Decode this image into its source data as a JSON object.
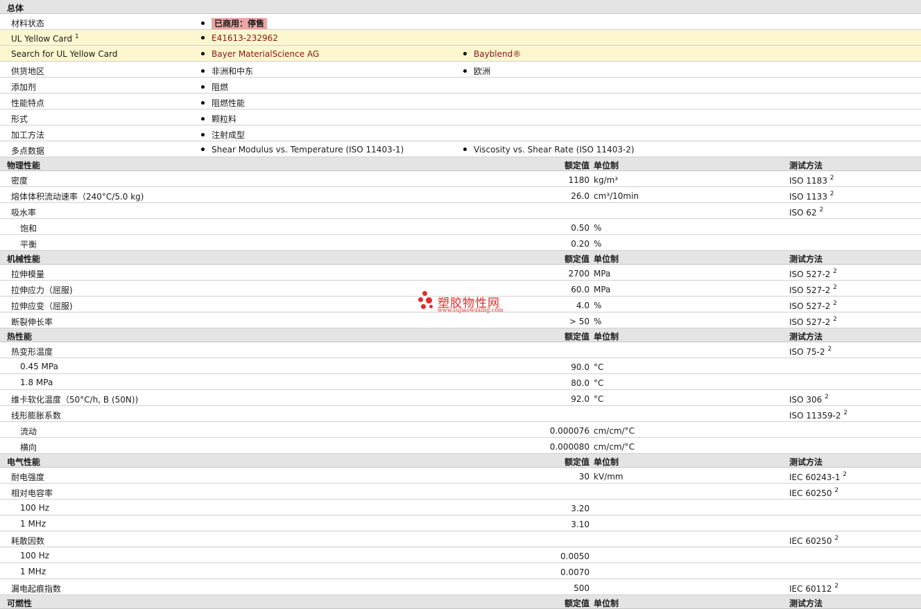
{
  "general": {
    "title": "总体",
    "material_status": {
      "label": "材料状态",
      "value": "已商用：停售"
    },
    "ul_yellow_card": {
      "label": "UL Yellow Card",
      "sup": "1",
      "value": "E41613-232962"
    },
    "search_ul": {
      "label": "Search for UL Yellow Card",
      "values": [
        "Bayer MaterialScience AG",
        "Bayblend®"
      ]
    },
    "supply_region": {
      "label": "供货地区",
      "values": [
        "非洲和中东",
        "欧洲"
      ]
    },
    "additive": {
      "label": "添加剂",
      "values": [
        "阻燃"
      ]
    },
    "features": {
      "label": "性能特点",
      "values": [
        "阻燃性能"
      ]
    },
    "form": {
      "label": "形式",
      "values": [
        "颗粒料"
      ]
    },
    "processing": {
      "label": "加工方法",
      "values": [
        "注射成型"
      ]
    },
    "multipoint": {
      "label": "多点数据",
      "values": [
        "Shear Modulus vs. Temperature (ISO 11403-1)",
        "Viscosity vs. Shear Rate (ISO 11403-2)"
      ]
    }
  },
  "headers": {
    "value": "额定值",
    "unit": "单位制",
    "method": "测试方法"
  },
  "sections": [
    {
      "title": "物理性能",
      "rows": [
        {
          "label": "密度",
          "value": "1180",
          "unit": "kg/m³",
          "method": "ISO 1183",
          "sup": "2"
        },
        {
          "label": "熔体体积流动速率（240°C/5.0 kg)",
          "value": "26.0",
          "unit": "cm³/10min",
          "method": "ISO 1133",
          "sup": "2"
        },
        {
          "label": "吸水率",
          "value": "",
          "unit": "",
          "method": "ISO 62",
          "sup": "2"
        },
        {
          "label": "饱和",
          "sub": true,
          "value": "0.50",
          "unit": "%",
          "method": "",
          "sup": ""
        },
        {
          "label": "平衡",
          "sub": true,
          "value": "0.20",
          "unit": "%",
          "method": "",
          "sup": ""
        }
      ]
    },
    {
      "title": "机械性能",
      "rows": [
        {
          "label": "拉伸模量",
          "value": "2700",
          "unit": "MPa",
          "method": "ISO 527-2",
          "sup": "2"
        },
        {
          "label": "拉伸应力（屈服)",
          "value": "60.0",
          "unit": "MPa",
          "method": "ISO 527-2",
          "sup": "2"
        },
        {
          "label": "拉伸应变（屈服)",
          "value": "4.0",
          "unit": "%",
          "method": "ISO 527-2",
          "sup": "2"
        },
        {
          "label": "断裂伸长率",
          "value": "> 50",
          "unit": "%",
          "method": "ISO 527-2",
          "sup": "2"
        }
      ]
    },
    {
      "title": "热性能",
      "rows": [
        {
          "label": "热变形温度",
          "value": "",
          "unit": "",
          "method": "ISO 75-2",
          "sup": "2"
        },
        {
          "label": "0.45 MPa",
          "sub": true,
          "value": "90.0",
          "unit": "°C",
          "method": "",
          "sup": ""
        },
        {
          "label": "1.8 MPa",
          "sub": true,
          "value": "80.0",
          "unit": "°C",
          "method": "",
          "sup": ""
        },
        {
          "label": "维卡软化温度（50°C/h, B (50N))",
          "value": "92.0",
          "unit": "°C",
          "method": "ISO 306",
          "sup": "2"
        },
        {
          "label": "线形膨胀系数",
          "value": "",
          "unit": "",
          "method": "ISO 11359-2",
          "sup": "2"
        },
        {
          "label": "流动",
          "sub": true,
          "value": "0.000076",
          "unit": "cm/cm/°C",
          "method": "",
          "sup": ""
        },
        {
          "label": "横向",
          "sub": true,
          "value": "0.000080",
          "unit": "cm/cm/°C",
          "method": "",
          "sup": ""
        }
      ]
    },
    {
      "title": "电气性能",
      "rows": [
        {
          "label": "耐电强度",
          "value": "30",
          "unit": "kV/mm",
          "method": "IEC 60243-1",
          "sup": "2"
        },
        {
          "label": "相对电容率",
          "value": "",
          "unit": "",
          "method": "IEC 60250",
          "sup": "2"
        },
        {
          "label": "100 Hz",
          "sub": true,
          "value": "3.20",
          "unit": "",
          "method": "",
          "sup": ""
        },
        {
          "label": "1 MHz",
          "sub": true,
          "value": "3.10",
          "unit": "",
          "method": "",
          "sup": ""
        },
        {
          "label": "耗散因数",
          "value": "",
          "unit": "",
          "method": "IEC 60250",
          "sup": "2"
        },
        {
          "label": "100 Hz",
          "sub": true,
          "value": "0.0050",
          "unit": "",
          "method": "",
          "sup": ""
        },
        {
          "label": "1 MHz",
          "sub": true,
          "value": "0.0070",
          "unit": "",
          "method": "",
          "sup": ""
        },
        {
          "label": "漏电起痕指数",
          "value": "500",
          "unit": "",
          "method": "IEC 60112",
          "sup": "2"
        }
      ]
    },
    {
      "title": "可燃性",
      "rows": []
    }
  ],
  "watermark": {
    "text": "塑胶物性网",
    "url": "www.sujiaowuxing.com"
  }
}
